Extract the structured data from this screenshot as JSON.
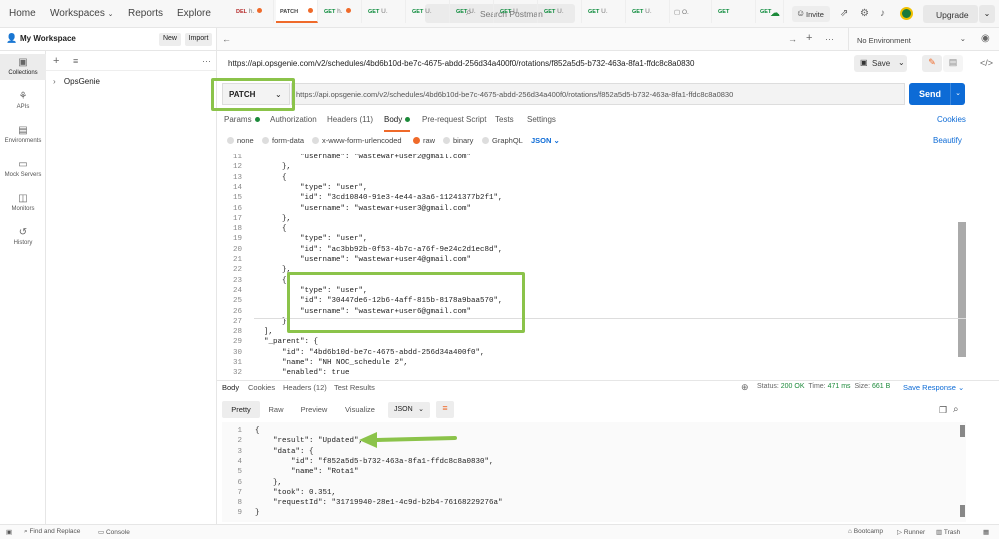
{
  "topbar": {
    "nav": [
      "Home",
      "Workspaces",
      "Reports",
      "Explore"
    ],
    "search_placeholder": "Search Postman",
    "invite": "Invite",
    "upgrade": "Upgrade"
  },
  "workspace": {
    "name": "My Workspace",
    "new_label": "New",
    "import_label": "Import",
    "tree": [
      {
        "label": "OpsGenie"
      }
    ]
  },
  "rail": [
    {
      "label": "Collections",
      "icon": "collections-icon",
      "selected": true
    },
    {
      "label": "APIs",
      "icon": "apis-icon"
    },
    {
      "label": "Environments",
      "icon": "environments-icon"
    },
    {
      "label": "Mock Servers",
      "icon": "mock-servers-icon"
    },
    {
      "label": "Monitors",
      "icon": "monitors-icon"
    },
    {
      "label": "History",
      "icon": "history-icon"
    }
  ],
  "tabs": [
    {
      "method": "DEL",
      "name": "h."
    },
    {
      "method": "PATCH",
      "name": ""
    },
    {
      "method": "GET",
      "name": "h."
    },
    {
      "method": "GET",
      "name": "U."
    },
    {
      "method": "GET",
      "name": "U."
    },
    {
      "method": "GET",
      "name": "U."
    },
    {
      "method": "GET",
      "name": "U."
    },
    {
      "method": "GET",
      "name": "U."
    },
    {
      "method": "GET",
      "name": "U."
    },
    {
      "method": "GET",
      "name": "U."
    },
    {
      "method": "",
      "name": "O."
    },
    {
      "method": "GET",
      "name": ""
    },
    {
      "method": "GET",
      "name": ""
    }
  ],
  "environment": "No Environment",
  "request": {
    "title_url": "https://api.opsgenie.com/v2/schedules/4bd6b10d-be7c-4675-abdd-256d34a400f0/rotations/f852a5d5-b732-463a-8fa1-ffdc8c8a0830",
    "save_label": "Save",
    "method": "PATCH",
    "url": "https://api.opsgenie.com/v2/schedules/4bd6b10d-be7c-4675-abdd-256d34a400f0/rotations/f852a5d5-b732-463a-8fa1-ffdc8c8a0830",
    "send_label": "Send",
    "tabs": [
      "Params",
      "Authorization",
      "Headers (11)",
      "Body",
      "Pre-request Script",
      "Tests",
      "Settings"
    ],
    "cookies_label": "Cookies",
    "body_modes": [
      "none",
      "form-data",
      "x-www-form-urlencoded",
      "raw",
      "binary",
      "GraphQL"
    ],
    "body_format": "JSON",
    "beautify_label": "Beautify",
    "lines": [
      {
        "n": "11",
        "t": "          \"username\": \"wastewar+user2@gmail.com\""
      },
      {
        "n": "12",
        "t": "      },"
      },
      {
        "n": "13",
        "t": "      {"
      },
      {
        "n": "14",
        "t": "          \"type\": \"user\","
      },
      {
        "n": "15",
        "t": "          \"id\": \"3cd10840-91e3-4e44-a3a6-11241377b2f1\","
      },
      {
        "n": "16",
        "t": "          \"username\": \"wastewar+user3@gmail.com\""
      },
      {
        "n": "17",
        "t": "      },"
      },
      {
        "n": "18",
        "t": "      {"
      },
      {
        "n": "19",
        "t": "          \"type\": \"user\","
      },
      {
        "n": "20",
        "t": "          \"id\": \"ac3bb92b-0f53-4b7c-a76f-9e24c2d1ec8d\","
      },
      {
        "n": "21",
        "t": "          \"username\": \"wastewar+user4@gmail.com\""
      },
      {
        "n": "22",
        "t": "      },"
      },
      {
        "n": "23",
        "t": "      {"
      },
      {
        "n": "24",
        "t": "          \"type\": \"user\","
      },
      {
        "n": "25",
        "t": "          \"id\": \"30447de6-12b6-4aff-815b-8178a9baa570\","
      },
      {
        "n": "26",
        "t": "          \"username\": \"wastewar+user6@gmail.com\""
      },
      {
        "n": "27",
        "t": "      }"
      },
      {
        "n": "28",
        "t": "  ],"
      },
      {
        "n": "29",
        "t": "  \"_parent\": {"
      },
      {
        "n": "30",
        "t": "      \"id\": \"4bd6b10d-be7c-4675-abdd-256d34a400f0\","
      },
      {
        "n": "31",
        "t": "      \"name\": \"NH NOC_schedule 2\","
      },
      {
        "n": "32",
        "t": "      \"enabled\": true"
      }
    ]
  },
  "response": {
    "tabs": [
      "Body",
      "Cookies",
      "Headers (12)",
      "Test Results"
    ],
    "status_label": "Status:",
    "status": "200 OK",
    "time_label": "Time:",
    "time": "471 ms",
    "size_label": "Size:",
    "size": "661 B",
    "save_response_label": "Save Response",
    "formats": [
      "Pretty",
      "Raw",
      "Preview",
      "Visualize"
    ],
    "format": "JSON",
    "lines": [
      {
        "n": "1",
        "t": "{"
      },
      {
        "n": "2",
        "t": "    \"result\": \"Updated\","
      },
      {
        "n": "3",
        "t": "    \"data\": {"
      },
      {
        "n": "4",
        "t": "        \"id\": \"f852a5d5-b732-463a-8fa1-ffdc8c8a0830\","
      },
      {
        "n": "5",
        "t": "        \"name\": \"Rota1\""
      },
      {
        "n": "6",
        "t": "    },"
      },
      {
        "n": "7",
        "t": "    \"took\": 0.351,"
      },
      {
        "n": "8",
        "t": "    \"requestId\": \"31719940-28e1-4c9d-b2b4-76168229276a\""
      },
      {
        "n": "9",
        "t": "}"
      }
    ]
  },
  "footer": {
    "find_replace": "Find and Replace",
    "console": "Console",
    "bootcamp": "Bootcamp",
    "runner": "Runner",
    "trash": "Trash"
  },
  "colors": {
    "accent": "#ef6a2a",
    "send": "#0d6bd6",
    "highlight": "#8bc34a",
    "ok": "#1c8a3a"
  }
}
